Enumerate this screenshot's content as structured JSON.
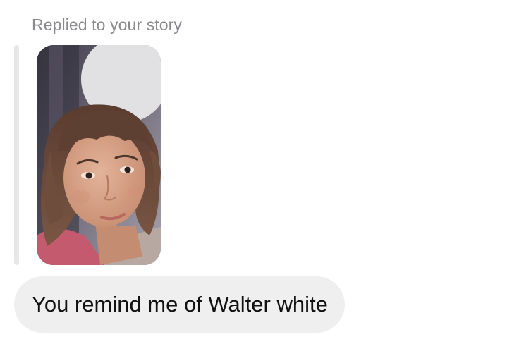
{
  "reply_context": {
    "label": "Replied to your story"
  },
  "story": {
    "thumbnail_icon": "selfie-photo",
    "colors": {
      "background_dark": "#4a4654",
      "background_light": "#d8dadd",
      "skin": "#d7a488",
      "hair": "#6b4a3a",
      "shirt": "#c45a6e"
    }
  },
  "message": {
    "text": "You remind me of Walter white"
  },
  "colors": {
    "bubble": "#efeff0",
    "label": "#8a8a8e",
    "quote_bar": "#e7e7ea"
  }
}
